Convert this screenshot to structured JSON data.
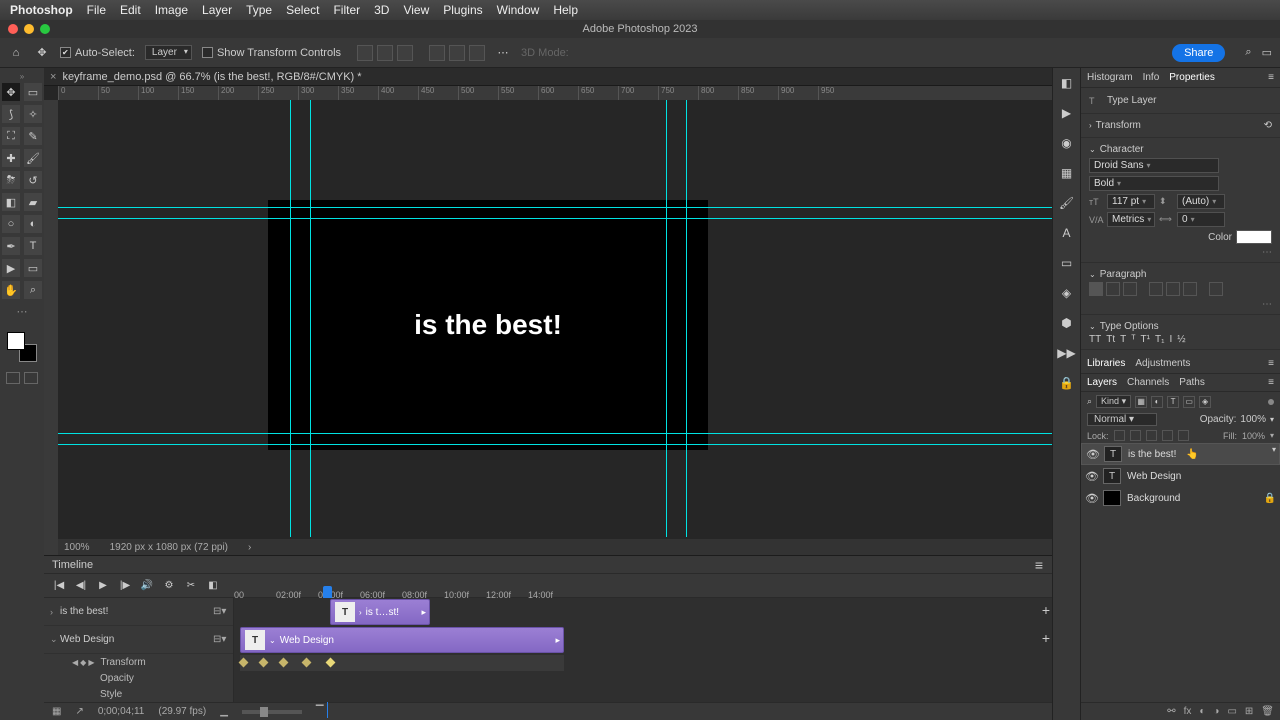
{
  "mac_menu": {
    "app": "Photoshop",
    "items": [
      "File",
      "Edit",
      "Image",
      "Layer",
      "Type",
      "Select",
      "Filter",
      "3D",
      "View",
      "Plugins",
      "Window",
      "Help"
    ]
  },
  "window_title": "Adobe Photoshop 2023",
  "options": {
    "auto_select_label": "Auto-Select:",
    "auto_select_value": "Layer",
    "show_transform_label": "Show Transform Controls",
    "mode3d_label": "3D Mode:",
    "share": "Share"
  },
  "doc_tab": "keyframe_demo.psd @ 66.7% (is the best!, RGB/8#/CMYK) *",
  "ruler_ticks": [
    "0",
    "50",
    "100",
    "150",
    "200",
    "250",
    "300",
    "350",
    "400",
    "450",
    "500",
    "550",
    "600",
    "650",
    "700",
    "750",
    "800",
    "850",
    "900",
    "950"
  ],
  "canvas_text": "is the best!",
  "status": {
    "zoom": "100%",
    "dims": "1920 px x 1080 px (72 ppi)"
  },
  "timeline": {
    "title": "Timeline",
    "ticks": [
      "00",
      "02:00f",
      "04:00f",
      "06:00f",
      "08:00f",
      "10:00f",
      "12:00f",
      "14:00f"
    ],
    "track1": {
      "name": "is the best!",
      "clip": "is t…st!"
    },
    "track2": {
      "name": "Web Design",
      "clip": "Web Design",
      "props": [
        "Transform",
        "Opacity",
        "Style"
      ]
    },
    "footer": {
      "tc": "0;00;04;11",
      "fps": "(29.97 fps)"
    }
  },
  "properties": {
    "tabs": [
      "Histogram",
      "Info",
      "Properties"
    ],
    "type_layer": "Type Layer",
    "transform": "Transform",
    "character": "Character",
    "font": "Droid Sans",
    "weight": "Bold",
    "size": "117 pt",
    "leading": "(Auto)",
    "kerning": "Metrics",
    "tracking": "0",
    "color_label": "Color",
    "paragraph": "Paragraph",
    "type_options": "Type Options"
  },
  "libraries_tabs": [
    "Libraries",
    "Adjustments"
  ],
  "layers": {
    "tabs": [
      "Layers",
      "Channels",
      "Paths"
    ],
    "kind": "Kind",
    "blend": "Normal",
    "opacity_label": "Opacity:",
    "opacity": "100%",
    "lock_label": "Lock:",
    "fill_label": "Fill:",
    "fill": "100%",
    "items": [
      {
        "name": "is the best!",
        "type": "T",
        "sel": true
      },
      {
        "name": "Web Design",
        "type": "T",
        "sel": false
      },
      {
        "name": "Background",
        "type": "bg",
        "sel": false,
        "locked": true
      }
    ]
  }
}
